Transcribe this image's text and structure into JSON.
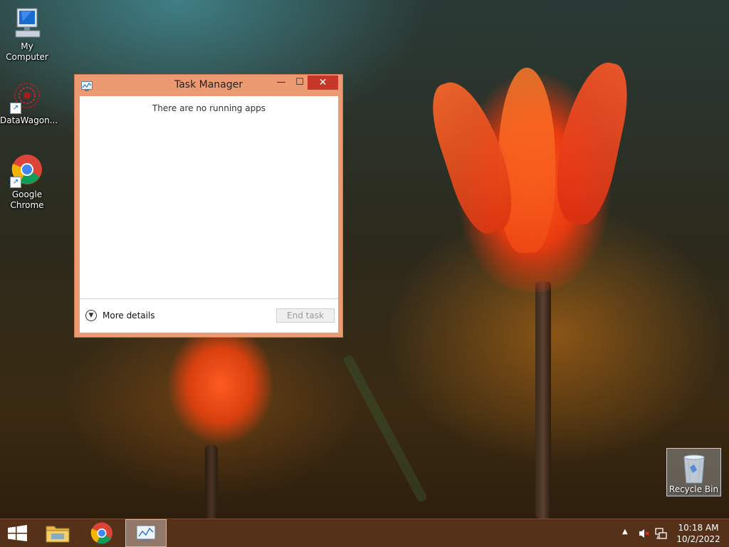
{
  "desktop": {
    "icons": [
      {
        "label": "My Computer",
        "icon": "computer-icon"
      },
      {
        "label": "DataWagon...",
        "icon": "datawagon-icon"
      },
      {
        "label": "Google Chrome",
        "icon": "chrome-icon"
      }
    ],
    "recycle_bin": {
      "label": "Recycle Bin",
      "icon": "recycle-bin-icon"
    }
  },
  "task_manager": {
    "title": "Task Manager",
    "empty_message": "There are no running apps",
    "more_details_label": "More details",
    "end_task_label": "End task",
    "min_glyph": "—",
    "max_glyph": "☐",
    "close_glyph": "✕",
    "accent_color": "#eb9a72"
  },
  "taskbar": {
    "items": [
      {
        "name": "start",
        "icon": "windows-logo-icon"
      },
      {
        "name": "file-explorer",
        "icon": "folder-icon"
      },
      {
        "name": "google-chrome",
        "icon": "chrome-icon"
      },
      {
        "name": "task-manager",
        "icon": "task-manager-icon",
        "active": true
      }
    ],
    "tray": {
      "chevron": "▲",
      "volume_icon": "volume-muted-icon",
      "network_icon": "network-icon"
    },
    "clock": {
      "time": "10:18 AM",
      "date": "10/2/2022"
    }
  }
}
